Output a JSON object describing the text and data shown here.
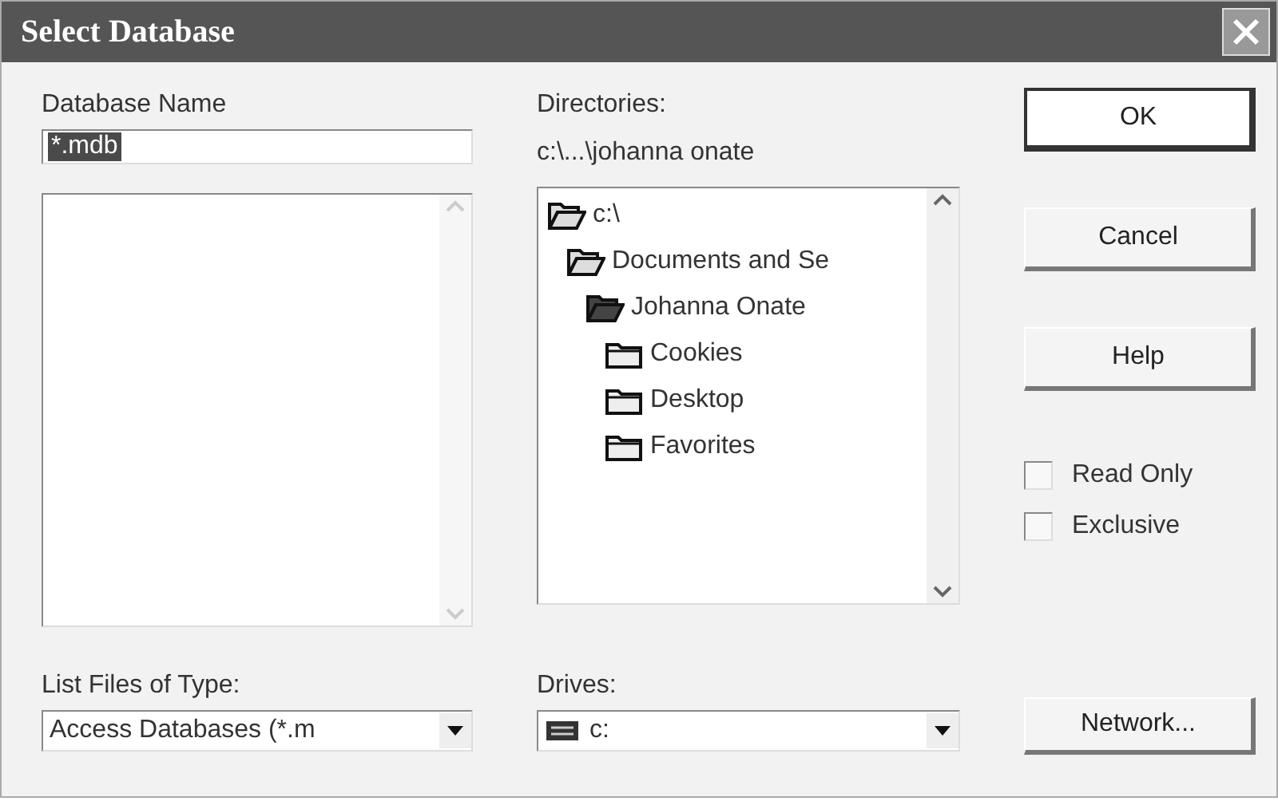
{
  "window": {
    "title": "Select Database"
  },
  "database_name": {
    "label": "Database Name",
    "value": "*.mdb",
    "selected": true
  },
  "directories": {
    "label": "Directories:",
    "path": "c:\\...\\johanna onate",
    "tree": [
      {
        "label": "c:\\",
        "expanded": true,
        "children": [
          {
            "label": "Documents and Se",
            "expanded": true,
            "children": [
              {
                "label": "Johanna Onate",
                "expanded": true,
                "current": true,
                "children": [
                  {
                    "label": "Cookies",
                    "expanded": false
                  },
                  {
                    "label": "Desktop",
                    "expanded": false
                  },
                  {
                    "label": "Favorites",
                    "expanded": false
                  }
                ]
              }
            ]
          }
        ]
      }
    ]
  },
  "buttons": [
    {
      "label": "OK",
      "default": true
    },
    {
      "label": "Cancel",
      "default": false
    },
    {
      "label": "Help",
      "default": false
    }
  ],
  "options": [
    {
      "label": "Read Only",
      "checked": false
    },
    {
      "label": "Exclusive",
      "checked": false
    }
  ],
  "file_type": {
    "label": "List Files of Type:",
    "value": "Access Databases (*.m"
  },
  "drives": {
    "label": "Drives:",
    "value": "c:"
  },
  "network_button": {
    "label": "Network..."
  }
}
